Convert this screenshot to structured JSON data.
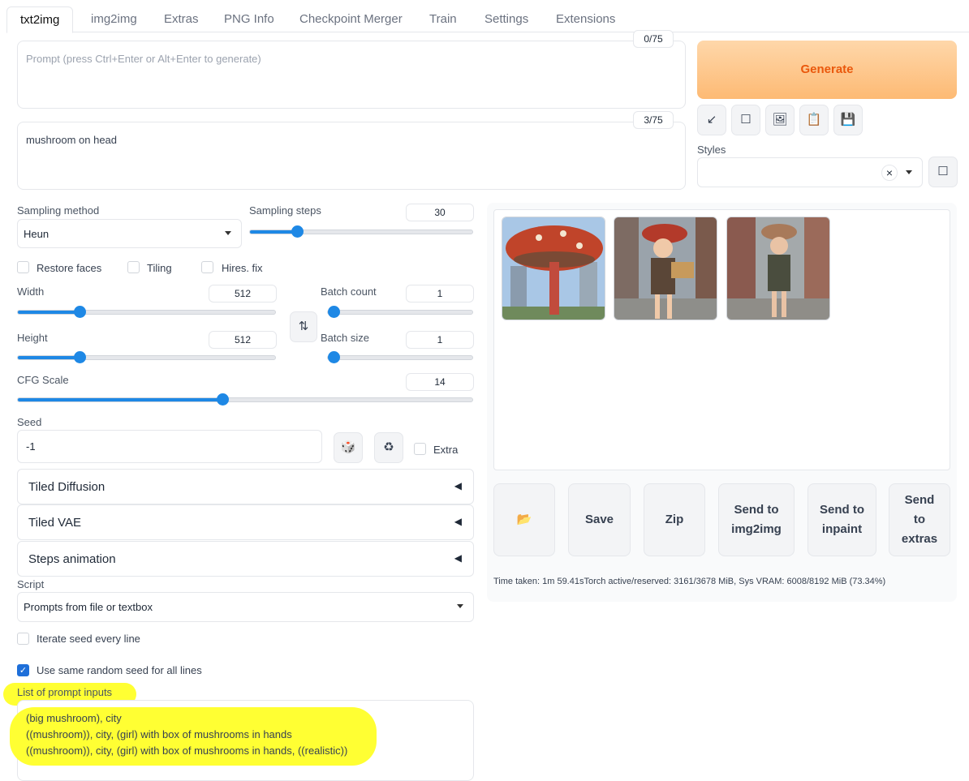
{
  "tabs": [
    "txt2img",
    "img2img",
    "Extras",
    "PNG Info",
    "Checkpoint Merger",
    "Train",
    "Settings",
    "Extensions"
  ],
  "prompt": {
    "placeholder": "Prompt (press Ctrl+Enter or Alt+Enter to generate)",
    "value": "",
    "counter": "0/75"
  },
  "negative_prompt": {
    "value": "mushroom on head",
    "counter": "3/75"
  },
  "generate_label": "Generate",
  "tool_icons": [
    "arrow-icon",
    "square-icon",
    "picture-icon",
    "clipboard-icon",
    "save-icon"
  ],
  "styles": {
    "label": "Styles",
    "clear": "×"
  },
  "sampling_method": {
    "label": "Sampling method",
    "value": "Heun"
  },
  "sampling_steps": {
    "label": "Sampling steps",
    "value": "30",
    "fraction": 0.21
  },
  "checkboxes": {
    "restore_faces": "Restore faces",
    "tiling": "Tiling",
    "hires_fix": "Hires. fix"
  },
  "width": {
    "label": "Width",
    "value": "512",
    "fraction": 0.24
  },
  "height": {
    "label": "Height",
    "value": "512",
    "fraction": 0.24
  },
  "batch_count": {
    "label": "Batch count",
    "value": "1",
    "fraction": 0
  },
  "batch_size": {
    "label": "Batch size",
    "value": "1",
    "fraction": 0
  },
  "cfg_scale": {
    "label": "CFG Scale",
    "value": "14",
    "fraction": 0.45
  },
  "seed": {
    "label": "Seed",
    "value": "-1",
    "extra": "Extra"
  },
  "accordions": [
    "Tiled Diffusion",
    "Tiled VAE",
    "Steps animation"
  ],
  "script": {
    "label": "Script",
    "value": "Prompts from file or textbox"
  },
  "iterate_seed": "Iterate seed every line",
  "same_seed": "Use same random seed for all lines",
  "prompt_inputs": {
    "label": "List of prompt inputs",
    "lines": [
      "(big mushroom), city",
      "((mushroom)), city, (girl) with box of mushrooms in hands",
      "((mushroom)), city, (girl) with box of mushrooms  in hands, ((realistic))"
    ]
  },
  "output_buttons": {
    "save": "Save",
    "zip": "Zip",
    "img2img": "Send to img2img",
    "inpaint": "Send to inpaint",
    "extras": "Send to extras"
  },
  "status": "Time taken: 1m 59.41sTorch active/reserved: 3161/3678 MiB, Sys VRAM: 6008/8192 MiB (73.34%)",
  "colors": {
    "accent": "#1e88e5",
    "generate": "#ea580c",
    "highlight": "#ffff33"
  }
}
